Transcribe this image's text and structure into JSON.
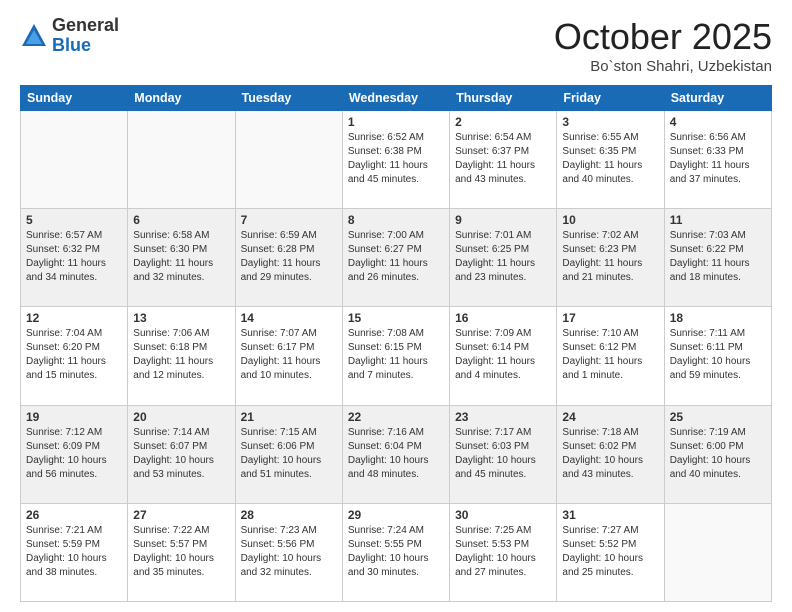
{
  "header": {
    "logo_general": "General",
    "logo_blue": "Blue",
    "month_title": "October 2025",
    "location": "Bo`ston Shahri, Uzbekistan"
  },
  "weekdays": [
    "Sunday",
    "Monday",
    "Tuesday",
    "Wednesday",
    "Thursday",
    "Friday",
    "Saturday"
  ],
  "weeks": [
    [
      {
        "day": "",
        "sunrise": "",
        "sunset": "",
        "daylight": ""
      },
      {
        "day": "",
        "sunrise": "",
        "sunset": "",
        "daylight": ""
      },
      {
        "day": "",
        "sunrise": "",
        "sunset": "",
        "daylight": ""
      },
      {
        "day": "1",
        "sunrise": "Sunrise: 6:52 AM",
        "sunset": "Sunset: 6:38 PM",
        "daylight": "Daylight: 11 hours and 45 minutes."
      },
      {
        "day": "2",
        "sunrise": "Sunrise: 6:54 AM",
        "sunset": "Sunset: 6:37 PM",
        "daylight": "Daylight: 11 hours and 43 minutes."
      },
      {
        "day": "3",
        "sunrise": "Sunrise: 6:55 AM",
        "sunset": "Sunset: 6:35 PM",
        "daylight": "Daylight: 11 hours and 40 minutes."
      },
      {
        "day": "4",
        "sunrise": "Sunrise: 6:56 AM",
        "sunset": "Sunset: 6:33 PM",
        "daylight": "Daylight: 11 hours and 37 minutes."
      }
    ],
    [
      {
        "day": "5",
        "sunrise": "Sunrise: 6:57 AM",
        "sunset": "Sunset: 6:32 PM",
        "daylight": "Daylight: 11 hours and 34 minutes."
      },
      {
        "day": "6",
        "sunrise": "Sunrise: 6:58 AM",
        "sunset": "Sunset: 6:30 PM",
        "daylight": "Daylight: 11 hours and 32 minutes."
      },
      {
        "day": "7",
        "sunrise": "Sunrise: 6:59 AM",
        "sunset": "Sunset: 6:28 PM",
        "daylight": "Daylight: 11 hours and 29 minutes."
      },
      {
        "day": "8",
        "sunrise": "Sunrise: 7:00 AM",
        "sunset": "Sunset: 6:27 PM",
        "daylight": "Daylight: 11 hours and 26 minutes."
      },
      {
        "day": "9",
        "sunrise": "Sunrise: 7:01 AM",
        "sunset": "Sunset: 6:25 PM",
        "daylight": "Daylight: 11 hours and 23 minutes."
      },
      {
        "day": "10",
        "sunrise": "Sunrise: 7:02 AM",
        "sunset": "Sunset: 6:23 PM",
        "daylight": "Daylight: 11 hours and 21 minutes."
      },
      {
        "day": "11",
        "sunrise": "Sunrise: 7:03 AM",
        "sunset": "Sunset: 6:22 PM",
        "daylight": "Daylight: 11 hours and 18 minutes."
      }
    ],
    [
      {
        "day": "12",
        "sunrise": "Sunrise: 7:04 AM",
        "sunset": "Sunset: 6:20 PM",
        "daylight": "Daylight: 11 hours and 15 minutes."
      },
      {
        "day": "13",
        "sunrise": "Sunrise: 7:06 AM",
        "sunset": "Sunset: 6:18 PM",
        "daylight": "Daylight: 11 hours and 12 minutes."
      },
      {
        "day": "14",
        "sunrise": "Sunrise: 7:07 AM",
        "sunset": "Sunset: 6:17 PM",
        "daylight": "Daylight: 11 hours and 10 minutes."
      },
      {
        "day": "15",
        "sunrise": "Sunrise: 7:08 AM",
        "sunset": "Sunset: 6:15 PM",
        "daylight": "Daylight: 11 hours and 7 minutes."
      },
      {
        "day": "16",
        "sunrise": "Sunrise: 7:09 AM",
        "sunset": "Sunset: 6:14 PM",
        "daylight": "Daylight: 11 hours and 4 minutes."
      },
      {
        "day": "17",
        "sunrise": "Sunrise: 7:10 AM",
        "sunset": "Sunset: 6:12 PM",
        "daylight": "Daylight: 11 hours and 1 minute."
      },
      {
        "day": "18",
        "sunrise": "Sunrise: 7:11 AM",
        "sunset": "Sunset: 6:11 PM",
        "daylight": "Daylight: 10 hours and 59 minutes."
      }
    ],
    [
      {
        "day": "19",
        "sunrise": "Sunrise: 7:12 AM",
        "sunset": "Sunset: 6:09 PM",
        "daylight": "Daylight: 10 hours and 56 minutes."
      },
      {
        "day": "20",
        "sunrise": "Sunrise: 7:14 AM",
        "sunset": "Sunset: 6:07 PM",
        "daylight": "Daylight: 10 hours and 53 minutes."
      },
      {
        "day": "21",
        "sunrise": "Sunrise: 7:15 AM",
        "sunset": "Sunset: 6:06 PM",
        "daylight": "Daylight: 10 hours and 51 minutes."
      },
      {
        "day": "22",
        "sunrise": "Sunrise: 7:16 AM",
        "sunset": "Sunset: 6:04 PM",
        "daylight": "Daylight: 10 hours and 48 minutes."
      },
      {
        "day": "23",
        "sunrise": "Sunrise: 7:17 AM",
        "sunset": "Sunset: 6:03 PM",
        "daylight": "Daylight: 10 hours and 45 minutes."
      },
      {
        "day": "24",
        "sunrise": "Sunrise: 7:18 AM",
        "sunset": "Sunset: 6:02 PM",
        "daylight": "Daylight: 10 hours and 43 minutes."
      },
      {
        "day": "25",
        "sunrise": "Sunrise: 7:19 AM",
        "sunset": "Sunset: 6:00 PM",
        "daylight": "Daylight: 10 hours and 40 minutes."
      }
    ],
    [
      {
        "day": "26",
        "sunrise": "Sunrise: 7:21 AM",
        "sunset": "Sunset: 5:59 PM",
        "daylight": "Daylight: 10 hours and 38 minutes."
      },
      {
        "day": "27",
        "sunrise": "Sunrise: 7:22 AM",
        "sunset": "Sunset: 5:57 PM",
        "daylight": "Daylight: 10 hours and 35 minutes."
      },
      {
        "day": "28",
        "sunrise": "Sunrise: 7:23 AM",
        "sunset": "Sunset: 5:56 PM",
        "daylight": "Daylight: 10 hours and 32 minutes."
      },
      {
        "day": "29",
        "sunrise": "Sunrise: 7:24 AM",
        "sunset": "Sunset: 5:55 PM",
        "daylight": "Daylight: 10 hours and 30 minutes."
      },
      {
        "day": "30",
        "sunrise": "Sunrise: 7:25 AM",
        "sunset": "Sunset: 5:53 PM",
        "daylight": "Daylight: 10 hours and 27 minutes."
      },
      {
        "day": "31",
        "sunrise": "Sunrise: 7:27 AM",
        "sunset": "Sunset: 5:52 PM",
        "daylight": "Daylight: 10 hours and 25 minutes."
      },
      {
        "day": "",
        "sunrise": "",
        "sunset": "",
        "daylight": ""
      }
    ]
  ]
}
